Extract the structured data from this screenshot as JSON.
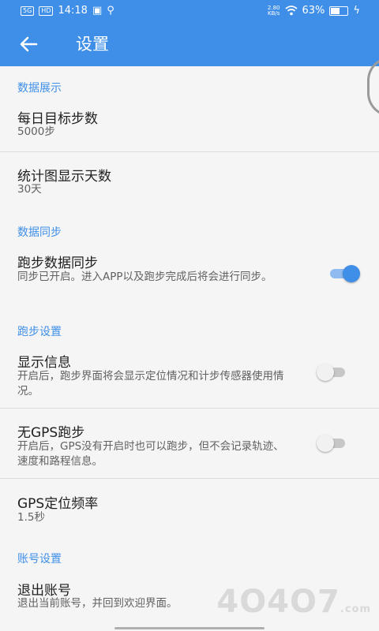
{
  "status_bar": {
    "time": "14:18",
    "signal_label": "5G",
    "hd_label": "HD",
    "net_speed_value": "2.80",
    "net_speed_unit": "KB/s",
    "battery": "63%",
    "battery_level": 0.63
  },
  "app_bar": {
    "title": "设置",
    "back_icon": "arrow-left-icon"
  },
  "sections": {
    "display": {
      "header": "数据展示"
    },
    "sync": {
      "header": "数据同步"
    },
    "run": {
      "header": "跑步设置"
    },
    "account": {
      "header": "账号设置"
    }
  },
  "settings": {
    "daily_goal": {
      "title": "每日目标步数",
      "value": "5000步"
    },
    "chart_days": {
      "title": "统计图显示天数",
      "value": "30天"
    },
    "run_sync": {
      "title": "跑步数据同步",
      "summary": "同步已开启。进入APP以及跑步完成后将会进行同步。",
      "enabled": true
    },
    "show_info": {
      "title": "显示信息",
      "summary": "开启后，跑步界面将会显示定位情况和计步传感器使用情况。",
      "enabled": false
    },
    "no_gps_run": {
      "title": "无GPS跑步",
      "summary": "开启后，GPS没有开启时也可以跑步，但不会记录轨迹、速度和路程信息。",
      "enabled": false
    },
    "gps_freq": {
      "title": "GPS定位频率",
      "value": "1.5秒"
    },
    "logout": {
      "title": "退出账号",
      "summary": "退出当前账号，并回到欢迎界面。"
    }
  },
  "watermark": {
    "text": "4O4O7",
    "suffix": ".com"
  },
  "colors": {
    "accent": "#3f8fe8",
    "background": "#f5f5f5",
    "switch_on_track": "#8fbbf0"
  }
}
